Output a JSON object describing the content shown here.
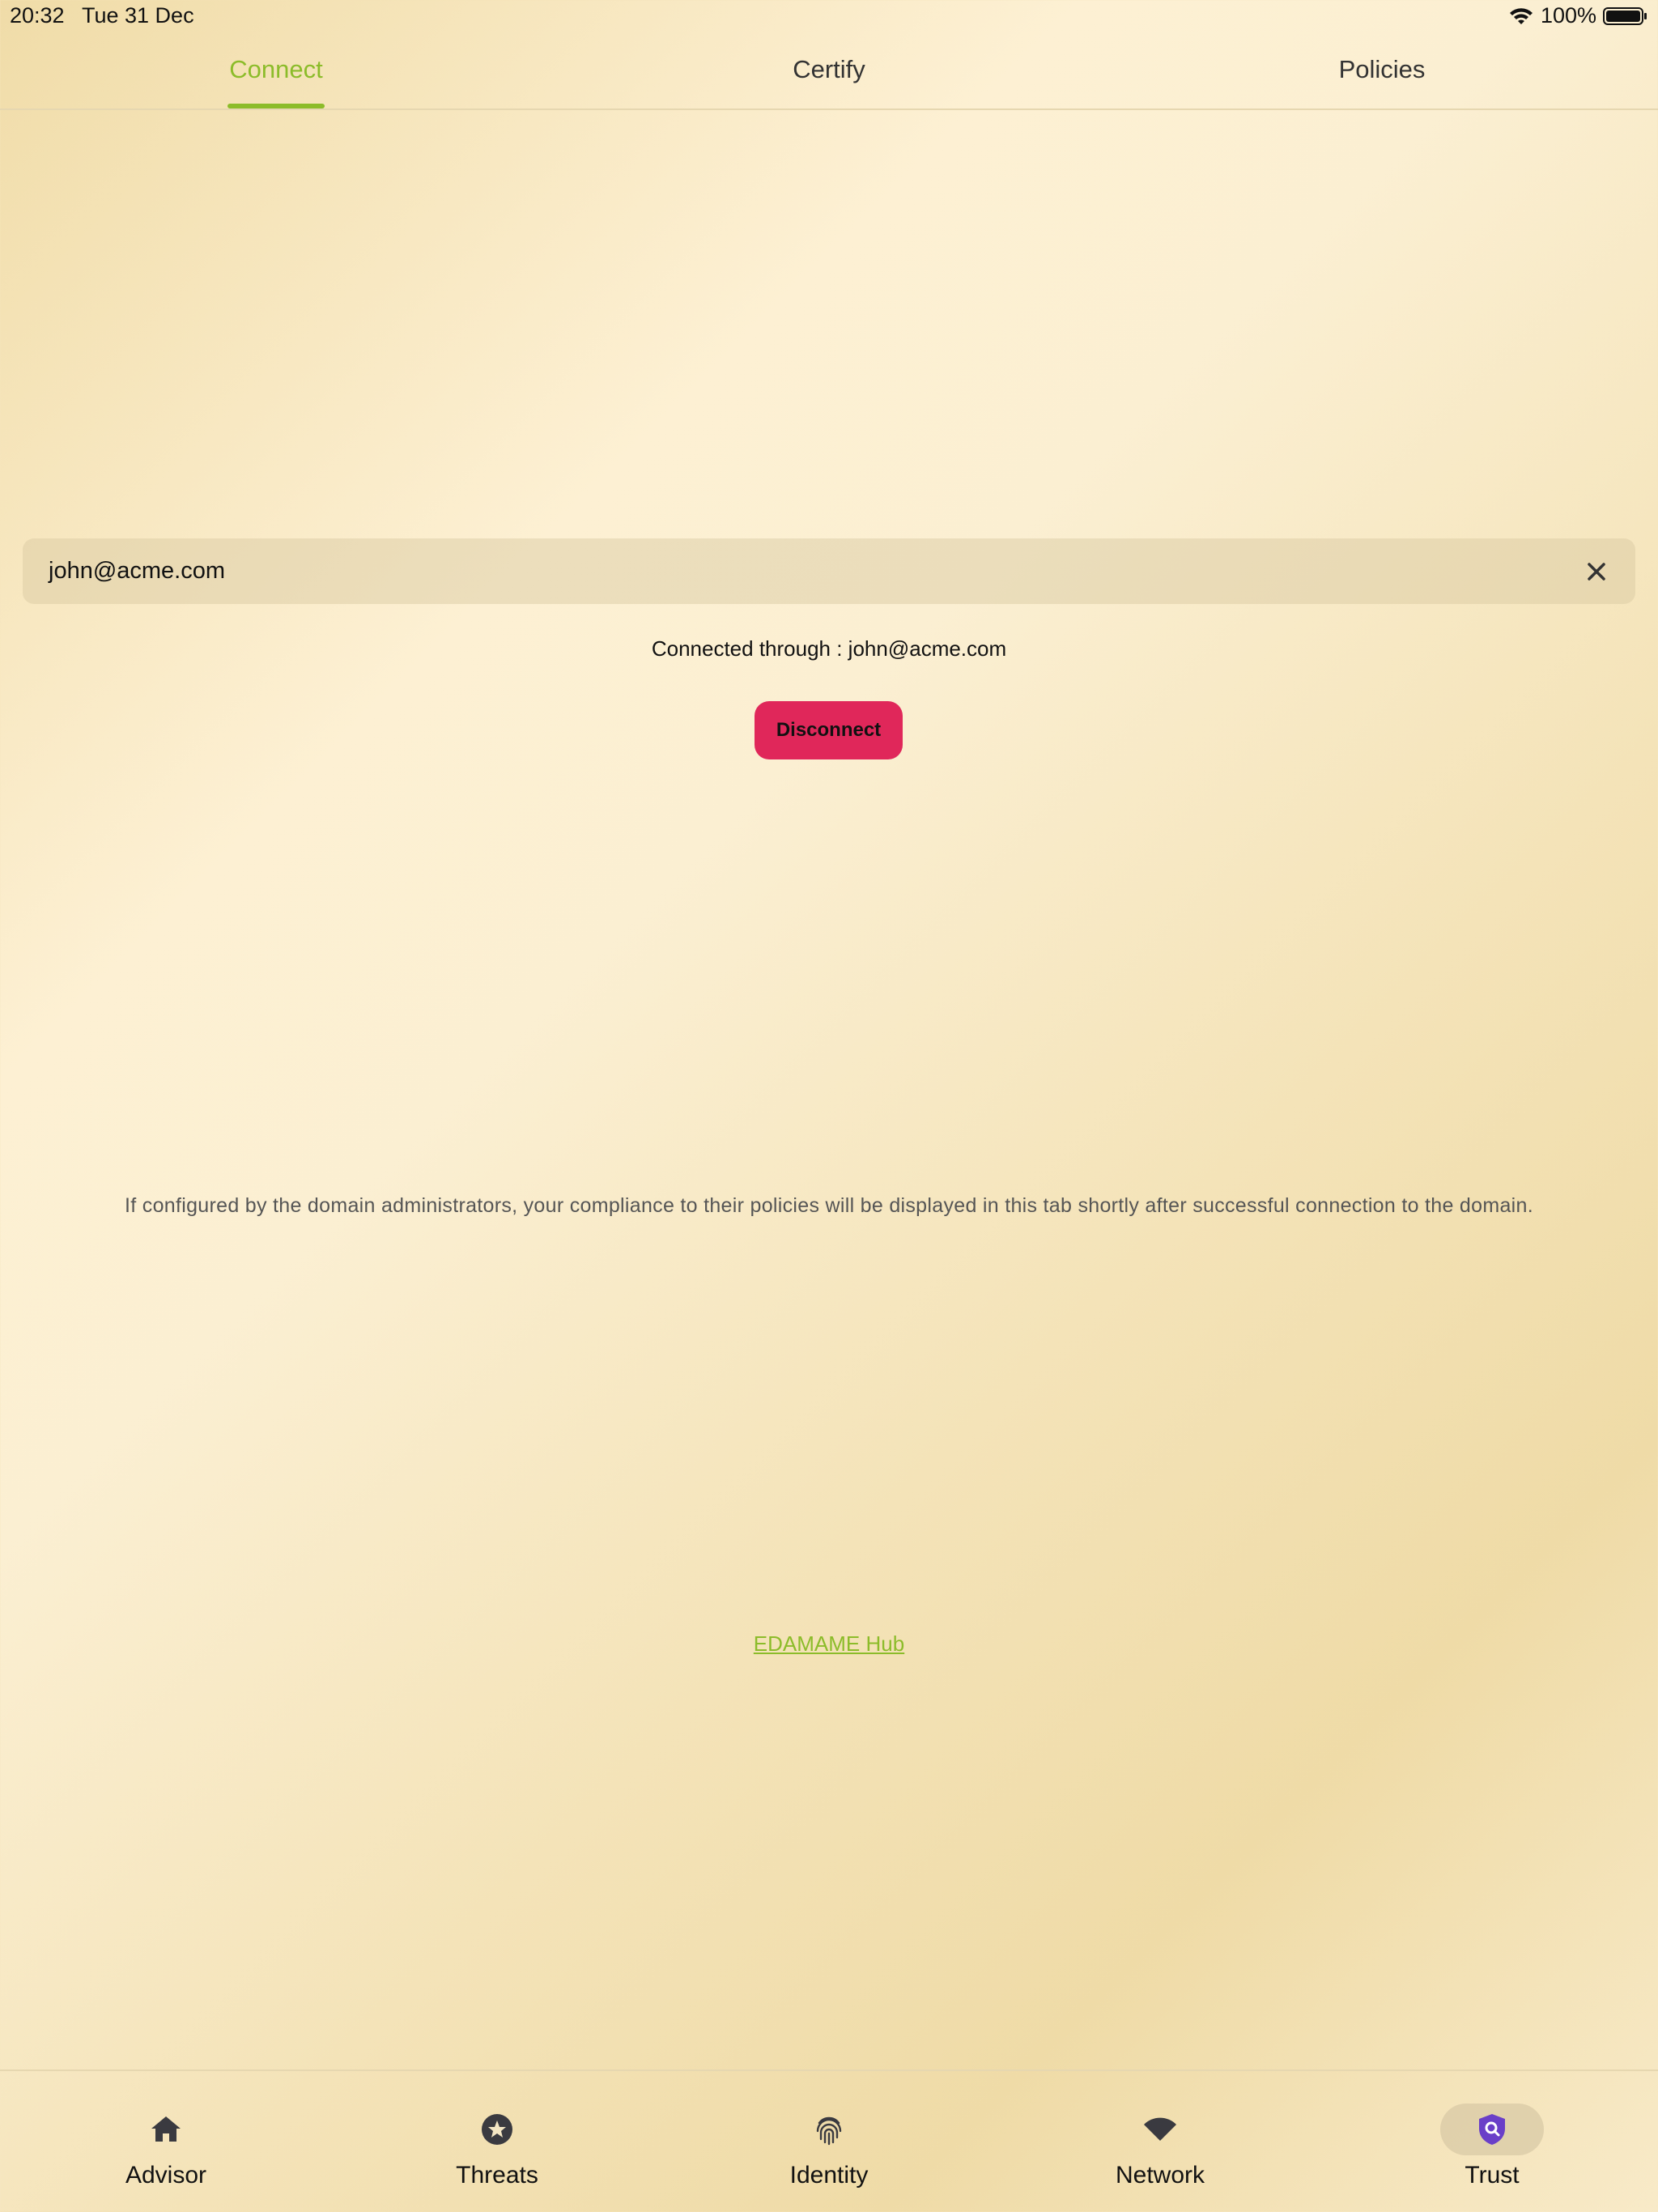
{
  "status_bar": {
    "time": "20:32",
    "date": "Tue 31 Dec",
    "battery": "100%"
  },
  "tabs": [
    {
      "label": "Connect",
      "active": true
    },
    {
      "label": "Certify",
      "active": false
    },
    {
      "label": "Policies",
      "active": false
    }
  ],
  "email_field": {
    "value": "john@acme.com"
  },
  "connection": {
    "status_text": "Connected through : john@acme.com",
    "disconnect_label": "Disconnect"
  },
  "info_text": "If configured by the domain administrators, your compliance to their policies will be displayed in this tab shortly after successful connection to the domain.",
  "hub_link": "EDAMAME Hub",
  "bottom_nav": [
    {
      "label": "Advisor",
      "icon": "home-icon",
      "active": false
    },
    {
      "label": "Threats",
      "icon": "star-badge-icon",
      "active": false
    },
    {
      "label": "Identity",
      "icon": "fingerprint-icon",
      "active": false
    },
    {
      "label": "Network",
      "icon": "wifi-icon",
      "active": false
    },
    {
      "label": "Trust",
      "icon": "shield-search-icon",
      "active": true
    }
  ],
  "colors": {
    "accent": "#8cbc2a",
    "danger": "#e0275a",
    "trust_icon": "#6a3fc8"
  }
}
